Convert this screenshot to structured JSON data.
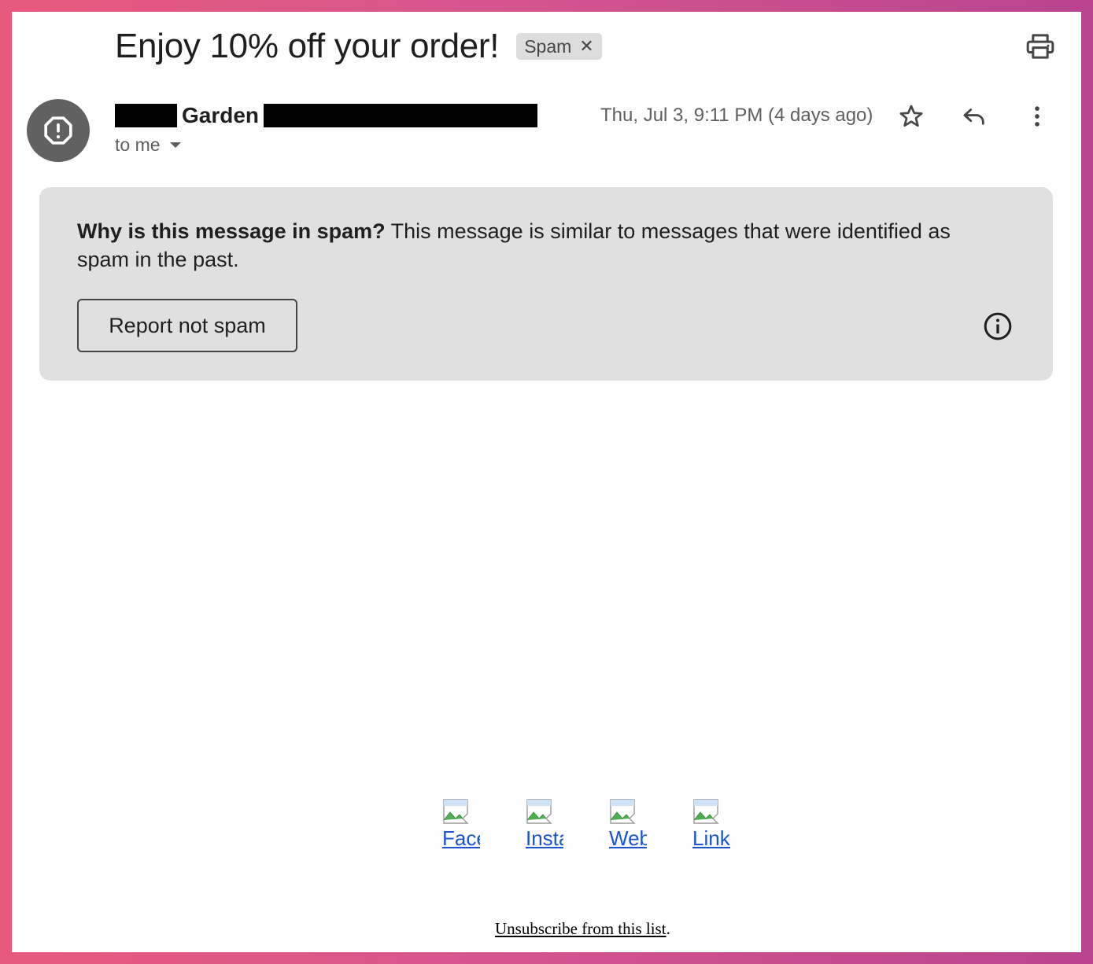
{
  "email": {
    "subject": "Enjoy 10% off your order!",
    "label": "Spam",
    "sender_name": "Garden",
    "recipient": "to me",
    "date": "Thu, Jul 3, 9:11 PM (4 days ago)"
  },
  "spam_notice": {
    "heading": "Why is this message in spam?",
    "body": " This message is similar to messages that were identified as spam in the past.",
    "report_button": "Report not spam"
  },
  "body": {
    "social_links": [
      {
        "label": "Facebook"
      },
      {
        "label": "Instagram"
      },
      {
        "label": "Website"
      },
      {
        "label": "LinkedIn"
      }
    ],
    "unsubscribe_label": "Unsubscribe from this list",
    "unsubscribe_suffix": "."
  },
  "icons": {
    "label_remove": "close-icon",
    "print": "print-icon",
    "avatar": "warning-icon",
    "star": "star-icon",
    "reply": "reply-icon",
    "more": "more-vert-icon",
    "info": "info-icon",
    "broken_image": "broken-image-icon"
  },
  "colors": {
    "spam_box_bg": "#e0e0e0",
    "avatar_bg": "#616161",
    "link": "#1a55d1"
  }
}
